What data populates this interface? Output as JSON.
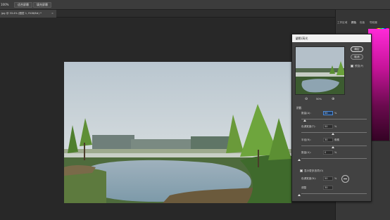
{
  "options_bar": {
    "zoom": "100%",
    "btn_fit": "适合屏幕",
    "btn_fill": "填充屏幕"
  },
  "doc_tab": {
    "title": "jpg @ 33.4% (图层 1, RGB/8#) *",
    "close": "×"
  },
  "right_dock": {
    "tabs": [
      "工作区域",
      "颜色",
      "色板",
      "导航器"
    ]
  },
  "dialog": {
    "title": "阴影/高光",
    "close": "×",
    "ok_label": "确定",
    "cancel_label": "取消",
    "preview_label": "预览(P)",
    "preview_checked": true,
    "zoom_level": "50%",
    "section_shadow": "阴影",
    "rows": [
      {
        "label": "数量(A):",
        "value": "50",
        "unit": "%",
        "slider": 0.5,
        "focused": false
      },
      {
        "label": "色调宽度(T):",
        "value": "50",
        "unit": "%",
        "slider": 0.5,
        "focused": false
      },
      {
        "label": "半径(R):",
        "value": "30",
        "unit": "像素",
        "slider": 0.14,
        "focused": false
      }
    ],
    "section_highlight": "高光",
    "highlight_rows": [
      {
        "label": "数量(U):",
        "value": "0",
        "unit": "%",
        "slider": 0.0
      },
      {
        "label": "色调宽度(N):",
        "value": "50",
        "unit": "%",
        "slider": 0.5
      }
    ],
    "section_adjust": "调整",
    "show_more_label": "显示更多选项(O)",
    "show_more_checked": true
  }
}
